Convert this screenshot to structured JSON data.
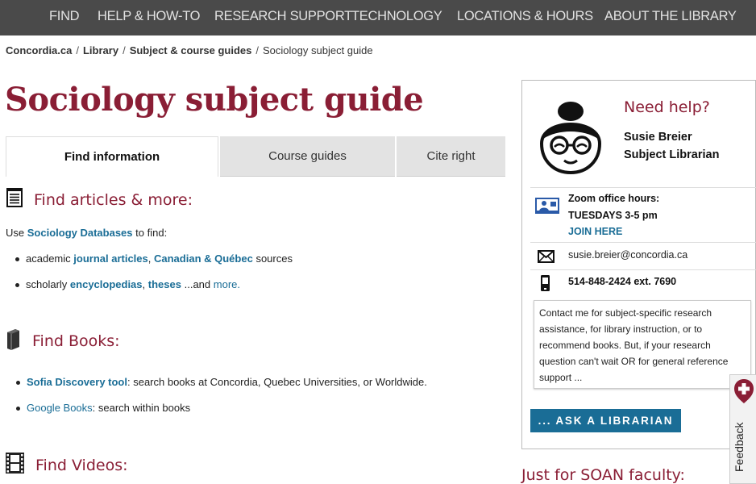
{
  "topnav": {
    "items": [
      {
        "label": "FIND"
      },
      {
        "label": "HELP & HOW-TO"
      },
      {
        "label": "RESEARCH SUPPORT"
      },
      {
        "label": "TECHNOLOGY"
      },
      {
        "label": "LOCATIONS & HOURS"
      },
      {
        "label": "ABOUT THE LIBRARY"
      }
    ]
  },
  "breadcrumb": {
    "items": [
      "Concordia.ca",
      "Library",
      "Subject & course guides"
    ],
    "separator": "/",
    "current": "Sociology subject guide"
  },
  "page_title": "Sociology subject guide",
  "tabs": [
    {
      "label": "Find information",
      "active": true
    },
    {
      "label": "Course guides",
      "active": false
    },
    {
      "label": "Cite right",
      "active": false
    }
  ],
  "articles": {
    "title": "Find articles & more:",
    "icon": "document-lines-icon",
    "intro_before": "Use",
    "intro_link": "Sociology Databases",
    "intro_after": "to find:",
    "b1_pre": "academic",
    "b1_link1": "journal articles",
    "b1_comma": ",",
    "b1_link2": "Canadian & Québec",
    "b1_post": "sources",
    "b2_pre": "scholarly",
    "b2_link1": "encyclopedias",
    "b2_comma": ",",
    "b2_link2": "theses",
    "b2_mid": "...and",
    "b2_link3": "more."
  },
  "books": {
    "title": "Find Books:",
    "icon": "book-icon",
    "b1_link": "Sofia Discovery tool",
    "b1_text": ": search books at Concordia, Quebec Universities, or Worldwide.",
    "b2_link": "Google Books",
    "b2_text": ": search within books"
  },
  "videos": {
    "title": "Find Videos:",
    "icon": "film-strip-icon"
  },
  "sidebar": {
    "need_help": "Need help?",
    "name": "Susie Breier",
    "role": "Subject Librarian",
    "zoom_label": "Zoom office hours:",
    "zoom_time": "TUESDAYS 3-5 pm",
    "zoom_link": "JOIN HERE",
    "email": "susie.breier@concordia.ca",
    "phone": "514-848-2424 ext. 7690",
    "note": "Contact me for subject-specific research assistance, for library instruction, or to recommend books. But, if your research question can't wait OR for general reference support ...",
    "ask_button": "... ASK A LIBRARIAN"
  },
  "soan_heading": "Just for SOAN faculty:",
  "feedback_label": "Feedback",
  "colors": {
    "brand": "#8a1e35",
    "link": "#1a6d96",
    "nav_bg": "#4a4a4a"
  }
}
